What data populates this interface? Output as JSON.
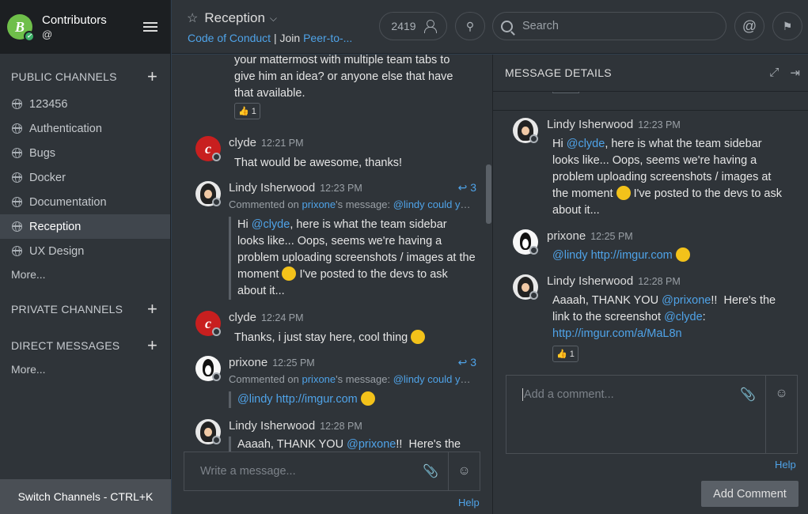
{
  "team": {
    "initial": "B",
    "name": "Contributors",
    "user": "@"
  },
  "sidebar": {
    "public_title": "PUBLIC CHANNELS",
    "channels": [
      {
        "label": "123456"
      },
      {
        "label": "Authentication"
      },
      {
        "label": "Bugs"
      },
      {
        "label": "Docker"
      },
      {
        "label": "Documentation"
      },
      {
        "label": "Reception"
      },
      {
        "label": "UX Design"
      }
    ],
    "more_public": "More...",
    "private_title": "PRIVATE CHANNELS",
    "dm_title": "DIRECT MESSAGES",
    "more_dm": "More...",
    "switch": "Switch Channels - CTRL+K"
  },
  "header": {
    "channel": "Reception",
    "purpose_link1": "Code of Conduct",
    "purpose_sep": " | Join ",
    "purpose_link2": "Peer-to-...",
    "member_count": "2419",
    "search_placeholder": "Search"
  },
  "center": {
    "top_text": "your mattermost with multiple team tabs to give him an idea? or anyone else that have that available.",
    "top_reaction_count": "1",
    "posts": [
      {
        "user": "clyde",
        "time": "12:21 PM",
        "text": "That would be awesome, thanks!"
      },
      {
        "user": "Lindy Isherwood",
        "time": "12:23 PM",
        "replies": "3",
        "ref_prefix": "Commented on ",
        "ref_user": "prixone",
        "ref_mid": "'s message: ",
        "ref_text": "@lindy could you...",
        "q_mention": "@clyde",
        "q_text1": "Hi ",
        "q_text2": ", here is what the team sidebar looks like... Oops, seems we're having a problem uploading screenshots / images at the moment ",
        "q_text3": " I've posted to the devs to ask about it..."
      },
      {
        "user": "clyde",
        "time": "12:24 PM",
        "text": "Thanks, i just stay here, cool thing "
      },
      {
        "user": "prixone",
        "time": "12:25 PM",
        "replies": "3",
        "ref_prefix": "Commented on ",
        "ref_user": "prixone",
        "ref_mid": "'s message: ",
        "ref_text": "@lindy could you...",
        "q_mention": "@lindy",
        "q_link": "http://imgur.com"
      },
      {
        "user": "Lindy Isherwood",
        "time": "12:28 PM",
        "q_text1": "Aaaah, THANK YOU ",
        "q_mention": "@prixone",
        "q_text2": "!!  Here's the"
      }
    ],
    "compose_placeholder": "Write a message...",
    "help": "Help"
  },
  "rhs": {
    "title": "MESSAGE DETAILS",
    "posts": [
      {
        "user": "Lindy Isherwood",
        "time": "12:23 PM",
        "t1": "Hi ",
        "mention": "@clyde",
        "t2": ", here is what the team sidebar looks like... Oops, seems we're having a problem uploading screenshots / images at the moment ",
        "t3": " I've posted to the devs to ask about it..."
      },
      {
        "user": "prixone",
        "time": "12:25 PM",
        "mention": "@lindy",
        "link": "http://imgur.com"
      },
      {
        "user": "Lindy Isherwood",
        "time": "12:28 PM",
        "t1": "Aaaah, THANK YOU ",
        "mention": "@prixone",
        "t2": "!!  Here's the link to the screenshot ",
        "mention2": "@clyde",
        "t3": ":",
        "link": "http://imgur.com/a/MaL8n",
        "reaction_count": "1"
      }
    ],
    "comment_placeholder": "Add a comment...",
    "help": "Help",
    "add_comment": "Add Comment"
  },
  "colors": {
    "sidebar_bg": "#2f3439",
    "link": "#4fa3e8",
    "active_item": "#40464d"
  }
}
